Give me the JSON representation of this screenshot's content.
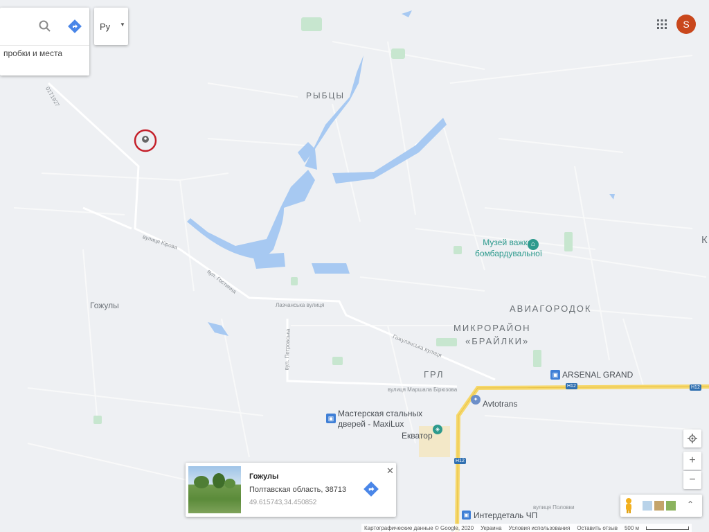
{
  "search": {
    "placeholder": "пробки и места",
    "language_label": "Ру"
  },
  "user": {
    "avatar_letter": "S"
  },
  "places": {
    "rybtsy": "РЫБЦЫ",
    "gozhuly": "Гожулы",
    "aviagorodok": "АВИАГОРОДОК",
    "mikroraion": "МИКРОРАЙОН",
    "brailki": "«БРАЙЛКИ»",
    "grl": "ГРЛ",
    "edge_k": "К"
  },
  "streets": {
    "s1": "01T1927",
    "s2": "вулиця Кірова",
    "s3": "вул. Гостинна",
    "s4": "Лазчанська вулиця",
    "s5": "вул. Петровська",
    "s6": "Гожулянська вулиця",
    "s7": "вулиця Маршала Бірюзова",
    "s8": "вулиця Половки"
  },
  "pois": {
    "museum_line1": "Музей важкої",
    "museum_line2": "бомбардувальної",
    "arsenal": "ARSENAL GRAND",
    "avtotrans": "Avtotrans",
    "masterskaya_line1": "Мастерская стальных",
    "masterskaya_line2": "дверей - MaxiLux",
    "ekvator": "Екватор",
    "interdetal": "Интердеталь ЧП"
  },
  "road_shields": {
    "h12_a": "H12",
    "h12_b": "H12",
    "h12_c": "H12"
  },
  "info_card": {
    "title": "Гожулы",
    "address": "Полтавская область, 38713",
    "coords": "49.615743,34.450852"
  },
  "footer": {
    "copyright": "Картографические данные © Google, 2020",
    "country": "Украина",
    "terms": "Условия использования",
    "feedback": "Оставить отзыв",
    "scale": "500 м"
  },
  "colors": {
    "water": "#a7c9f2",
    "park": "#c7e6cf",
    "road_major": "#f6d86b",
    "road_minor": "#ffffff",
    "marker_ring": "#c4202a",
    "avatar_bg": "#c9471c",
    "directions_blue": "#4a86e8"
  }
}
